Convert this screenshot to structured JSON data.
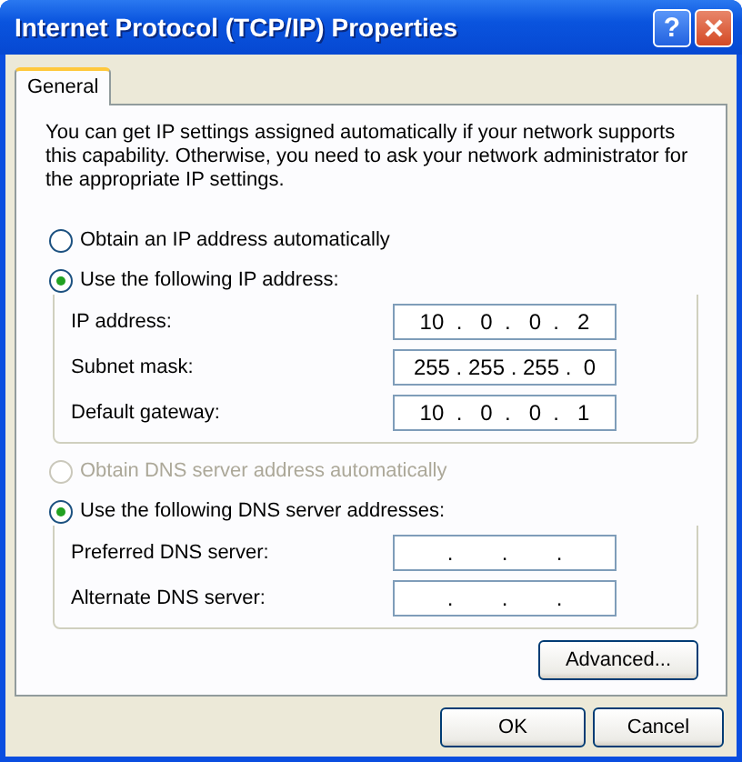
{
  "window": {
    "title": "Internet Protocol (TCP/IP) Properties",
    "help_button": "?"
  },
  "tabs": [
    {
      "label": "General",
      "selected": true
    }
  ],
  "description": "You can get IP settings assigned automatically if your network supports this capability. Otherwise, you need to ask your network administrator for the appropriate IP settings.",
  "ip_options": [
    {
      "label": "Obtain an IP address automatically",
      "selected": false,
      "disabled": false
    },
    {
      "label": "Use the following IP address:",
      "selected": true,
      "disabled": false,
      "fields": [
        {
          "label": "IP address:",
          "value": "10  .   0  .   0  .   2"
        },
        {
          "label": "Subnet mask:",
          "value": "255 . 255 . 255 .  0"
        },
        {
          "label": "Default gateway:",
          "value": "10  .   0  .   0  .   1"
        }
      ]
    }
  ],
  "dns_options": [
    {
      "label": "Obtain DNS server address automatically",
      "selected": false,
      "disabled": true
    },
    {
      "label": "Use the following DNS server addresses:",
      "selected": true,
      "disabled": false,
      "fields": [
        {
          "label": "Preferred DNS server:",
          "value": ".        .        ."
        },
        {
          "label": "Alternate DNS server:",
          "value": ".        .        ."
        }
      ]
    }
  ],
  "advanced_button": "Advanced...",
  "buttons": [
    "OK",
    "Cancel"
  ]
}
